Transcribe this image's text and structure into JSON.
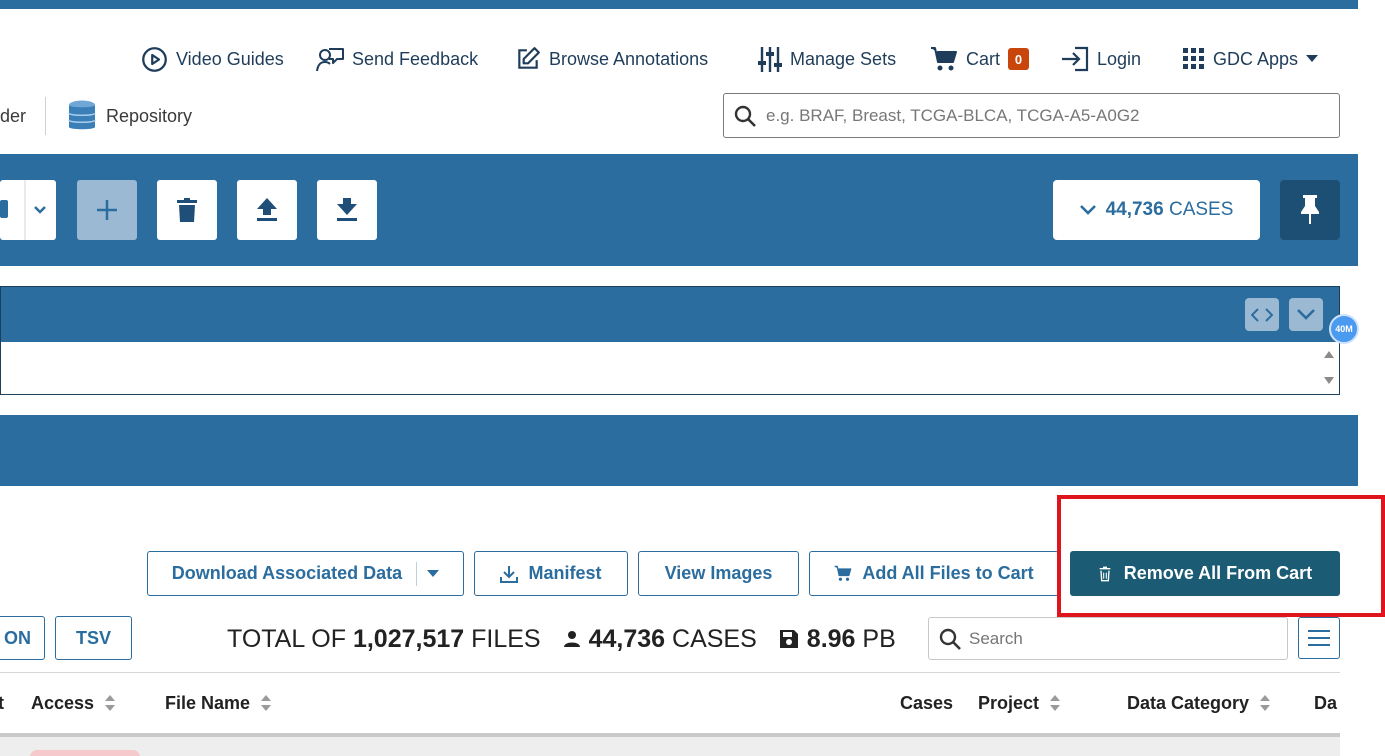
{
  "nav": {
    "video_guides": "Video Guides",
    "send_feedback": "Send Feedback",
    "browse_annotations": "Browse Annotations",
    "manage_sets": "Manage Sets",
    "cart": "Cart",
    "cart_count": "0",
    "login": "Login",
    "gdc_apps": "GDC Apps"
  },
  "subnav": {
    "partial_left": "der",
    "repository": "Repository"
  },
  "search": {
    "placeholder": "e.g. BRAF, Breast, TCGA-BLCA, TCGA-A5-A0G2"
  },
  "cohort": {
    "case_count": "44,736",
    "case_unit": "CASES"
  },
  "query": {
    "memory_badge": "40M"
  },
  "actions": {
    "download_associated": "Download Associated Data",
    "manifest": "Manifest",
    "view_images": "View Images",
    "add_all_files": "Add All Files to Cart",
    "remove_all": "Remove All From Cart"
  },
  "export": {
    "json_partial": "ON",
    "tsv": "TSV"
  },
  "totals": {
    "prefix": "TOTAL OF",
    "files_count": "1,027,517",
    "files_unit": "FILES",
    "cases_count": "44,736",
    "cases_unit": "CASES",
    "size_value": "8.96",
    "size_unit": "PB"
  },
  "table_search": {
    "placeholder": "Search"
  },
  "table": {
    "columns": [
      "t",
      "Access",
      "File Name",
      "Cases",
      "Project",
      "Data Category",
      "Da"
    ]
  },
  "colors": {
    "brand_blue": "#2b6d9e",
    "dark_teal": "#1b5b74",
    "cart_badge": "#c8460c",
    "highlight_red": "#e0141c"
  }
}
